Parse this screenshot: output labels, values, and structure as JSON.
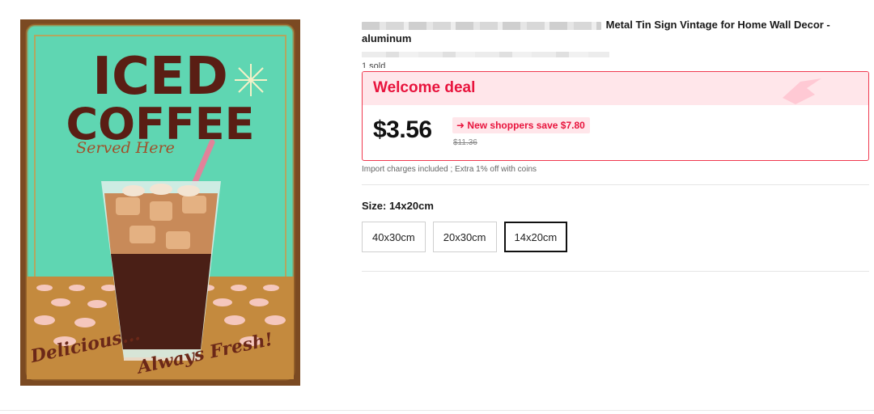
{
  "product": {
    "title_visible": "Metal Tin Sign Vintage for Home Wall Decor -",
    "title_line2": "aluminum",
    "sold": "1 sold",
    "image_alt_text": {
      "line1": "ICED",
      "line2": "COFFEE",
      "line3": "Served Here",
      "line4": "Delicious...",
      "line5": "Always Fresh!"
    }
  },
  "deal": {
    "title": "Welcome deal",
    "price": "$3.56",
    "badge": "New shoppers save $7.80",
    "original_price": "$11.36"
  },
  "import_note": "Import charges included ; Extra 1% off with coins",
  "size": {
    "label": "Size: 14x20cm",
    "options": [
      "40x30cm",
      "20x30cm",
      "14x20cm"
    ],
    "selected": "14x20cm"
  },
  "colors": {
    "accent": "#e8143d",
    "deal_bg": "#ffe6ea"
  }
}
